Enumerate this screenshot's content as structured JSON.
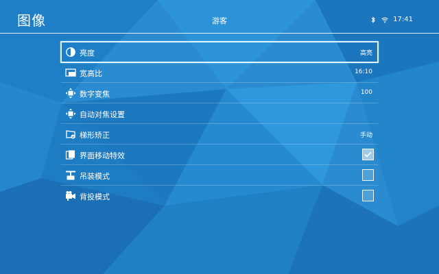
{
  "header": {
    "title": "图像",
    "user": "游客",
    "time": "17:41"
  },
  "status_icons": [
    "bluetooth-icon",
    "wifi-icon"
  ],
  "settings": [
    {
      "label": "亮度",
      "value": "高亮",
      "icon": "brightness-icon",
      "selected": true
    },
    {
      "label": "宽高比",
      "value": "16:10",
      "icon": "aspect-ratio-icon"
    },
    {
      "label": "数字变焦",
      "value": "100",
      "icon": "digital-zoom-icon"
    },
    {
      "label": "自动对焦设置",
      "value": "",
      "icon": "autofocus-icon"
    },
    {
      "label": "梯形矫正",
      "value": "手动",
      "icon": "keystone-icon"
    },
    {
      "label": "界面移动特效",
      "checked": true,
      "icon": "ui-motion-effect-icon"
    },
    {
      "label": "吊装模式",
      "checked": false,
      "icon": "ceiling-mount-icon"
    },
    {
      "label": "背投模式",
      "checked": false,
      "icon": "rear-projection-icon"
    }
  ],
  "colors": {
    "background": "#2a8bd0",
    "highlight_border": "#dff6ff"
  }
}
